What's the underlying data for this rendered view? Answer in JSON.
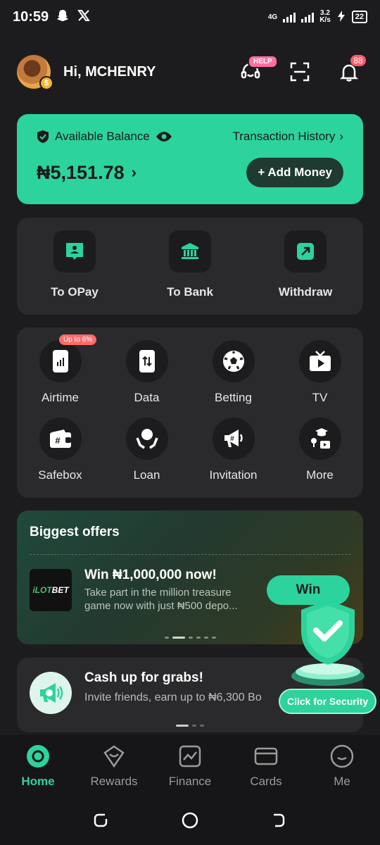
{
  "status_bar": {
    "time": "10:59",
    "network": "4G",
    "speed_value": "3.2",
    "speed_unit": "K/s",
    "battery": "22"
  },
  "header": {
    "greeting": "Hi, MCHENRY",
    "help_label": "HELP",
    "notification_count": "88"
  },
  "balance": {
    "label": "Available Balance",
    "amount": "₦5,151.78",
    "history_label": "Transaction History",
    "add_money_label": "+ Add Money"
  },
  "transfers": [
    {
      "label": "To OPay",
      "icon": "person-chat-icon"
    },
    {
      "label": "To Bank",
      "icon": "bank-icon"
    },
    {
      "label": "Withdraw",
      "icon": "withdraw-arrow-icon"
    }
  ],
  "services": {
    "promo": "Up to 6%",
    "items": [
      {
        "label": "Airtime",
        "icon": "phone-signal-icon"
      },
      {
        "label": "Data",
        "icon": "phone-data-icon"
      },
      {
        "label": "Betting",
        "icon": "soccer-ball-icon"
      },
      {
        "label": "TV",
        "icon": "tv-icon"
      },
      {
        "label": "Safebox",
        "icon": "wallet-icon"
      },
      {
        "label": "Loan",
        "icon": "hands-coin-icon"
      },
      {
        "label": "Invitation",
        "icon": "megaphone-icon"
      },
      {
        "label": "More",
        "icon": "more-apps-icon"
      }
    ]
  },
  "offers": {
    "title": "Biggest offers",
    "logo_text_a": "iLOT",
    "logo_text_b": "BET",
    "headline": "Win ₦1,000,000 now!",
    "description": "Take part in the million treasure game now with just ₦500 depo...",
    "button_label": "Win"
  },
  "cash": {
    "headline": "Cash up for grabs!",
    "description": "Invite friends, earn up to ₦6,300 Bo"
  },
  "security": {
    "label": "Click for Security"
  },
  "bottom_nav": [
    {
      "label": "Home",
      "icon": "home-icon",
      "active": true
    },
    {
      "label": "Rewards",
      "icon": "rewards-icon",
      "active": false
    },
    {
      "label": "Finance",
      "icon": "finance-chart-icon",
      "active": false
    },
    {
      "label": "Cards",
      "icon": "card-icon",
      "active": false
    },
    {
      "label": "Me",
      "icon": "me-icon",
      "active": false
    }
  ],
  "colors": {
    "accent": "#2dd39c",
    "background": "#1c1c1e",
    "card": "#2a2a2c"
  }
}
